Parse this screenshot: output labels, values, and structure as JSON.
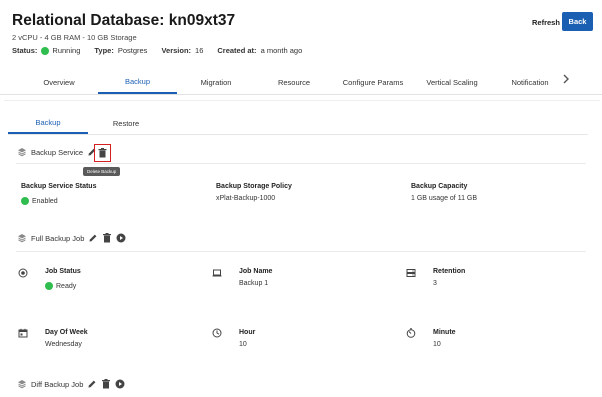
{
  "header": {
    "title": "Relational Database: kn09xt37",
    "subtitle": "2 vCPU - 4 GB RAM - 10 GB Storage",
    "status_label": "Status:",
    "status_value": "Running",
    "type_label": "Type:",
    "type_value": "Postgres",
    "version_label": "Version:",
    "version_value": "16",
    "created_label": "Created at:",
    "created_value": "a month ago",
    "refresh_label": "Refresh",
    "back_label": "Back"
  },
  "tabs": [
    {
      "label": "Overview"
    },
    {
      "label": "Backup"
    },
    {
      "label": "Migration"
    },
    {
      "label": "Resource"
    },
    {
      "label": "Configure Params"
    },
    {
      "label": "Vertical Scaling"
    },
    {
      "label": "Notification"
    }
  ],
  "subtabs": [
    {
      "label": "Backup"
    },
    {
      "label": "Restore"
    }
  ],
  "backup_service": {
    "title": "Backup Service",
    "tooltip": "Delete Backup",
    "status_label": "Backup Service Status",
    "status_value": "Enabled",
    "policy_label": "Backup Storage Policy",
    "policy_value": "xPlat-Backup-1000",
    "capacity_label": "Backup Capacity",
    "capacity_value": "1 GB usage of 11 GB"
  },
  "full_backup_job": {
    "title": "Full Backup Job",
    "job_status_label": "Job Status",
    "job_status_value": "Ready",
    "job_name_label": "Job Name",
    "job_name_value": "Backup 1",
    "retention_label": "Retention",
    "retention_value": "3",
    "day_label": "Day Of Week",
    "day_value": "Wednesday",
    "hour_label": "Hour",
    "hour_value": "10",
    "minute_label": "Minute",
    "minute_value": "10"
  },
  "diff_backup_job": {
    "title": "Diff Backup Job"
  },
  "colors": {
    "accent": "#1b5fb3",
    "status_green": "#2ebd4e",
    "highlight_red": "#d62020"
  }
}
